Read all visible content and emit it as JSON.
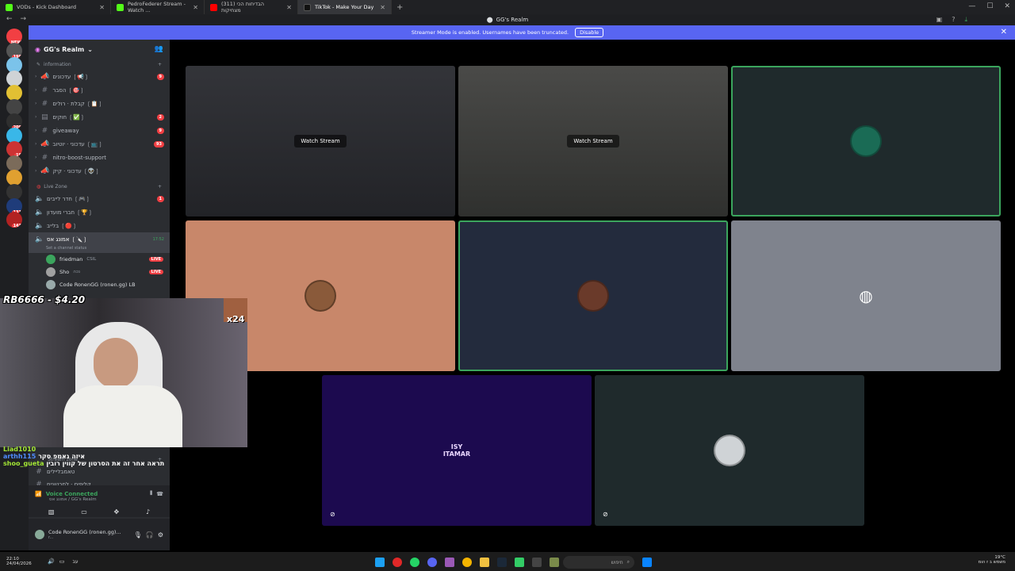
{
  "tabs": [
    {
      "title": "VODs - Kick Dashboard",
      "color": "#53fc18"
    },
    {
      "title": "PedroFederer Stream - Watch ...",
      "color": "#53fc18"
    },
    {
      "title": "(311) הבדיחות הכי מצחיקות",
      "color": "#ff0000"
    },
    {
      "title": "TikTok - Make Your Day",
      "color": "#111111"
    }
  ],
  "window": {
    "title": "GG's Realm"
  },
  "banner": {
    "text": "Streamer Mode is enabled. Usernames have been truncated.",
    "button": "Disable"
  },
  "server": {
    "name": "GG's Realm"
  },
  "servers": [
    {
      "badge": "NEW",
      "color": "#f23f43"
    },
    {
      "badge": "198",
      "color": "#555"
    },
    {
      "badge": "",
      "color": "#7bc3ea"
    },
    {
      "badge": "",
      "color": "#cfd3d6"
    },
    {
      "badge": "",
      "color": "#e2c033"
    },
    {
      "badge": "",
      "color": "#444"
    },
    {
      "badge": "209",
      "color": "#2f2f2f"
    },
    {
      "badge": "",
      "color": "#39b7e8"
    },
    {
      "badge": "19",
      "color": "#cc3333"
    },
    {
      "badge": "",
      "color": "#7b6b5a"
    },
    {
      "badge": "",
      "color": "#e0a030"
    },
    {
      "badge": "",
      "color": "#333"
    },
    {
      "badge": "131",
      "color": "#1f3c7a"
    },
    {
      "badge": "143",
      "color": "#b22222"
    }
  ],
  "categories": {
    "info": "information",
    "live": "Live Zone",
    "stream": "Stream zone"
  },
  "channels": [
    {
      "name": "עדכונים ❲📢❳",
      "badge": "9",
      "type": "ann"
    },
    {
      "name": "הסבר ❲🎯❳",
      "badge": "",
      "type": "text"
    },
    {
      "name": "קבלת · רולים ❲📋❳",
      "badge": "",
      "type": "text"
    },
    {
      "name": "חוקים ❲✅❳",
      "badge": "2",
      "type": "rules"
    },
    {
      "name": "giveaway",
      "badge": "9",
      "type": "text"
    },
    {
      "name": "עדכוני · יוטיוב ❲📺❳",
      "badge": "93",
      "type": "ann"
    },
    {
      "name": "nitro-boost-support",
      "badge": "",
      "type": "text"
    },
    {
      "name": "עדכוני · קיק ❲👽❳",
      "badge": "",
      "type": "ann"
    }
  ],
  "voice_channels": [
    {
      "name": "חדר לייבים ❲🎮❳",
      "badge": "1"
    },
    {
      "name": "חברי מועדון ❲🏆❳",
      "badge": ""
    },
    {
      "name": "בלייב ❲🔴❳",
      "badge": ""
    },
    {
      "name": "אמונג אס ❲🔪❳",
      "badge": "",
      "time": "17:52",
      "status": "Set a channel status"
    }
  ],
  "voice_users": [
    {
      "name": "friedman",
      "tag": "CSIL",
      "live": "LIVE",
      "color": "#3ba55d"
    },
    {
      "name": "Sho",
      "tag": "נכה",
      "live": "LIVE",
      "color": "#a0a0a0"
    },
    {
      "name": "Code RonenGG (ronen.gg) LB",
      "tag": "",
      "live": "",
      "color": "#9aa"
    }
  ],
  "stream_channels": [
    {
      "name": "טאמבליילים"
    },
    {
      "name": "קליפים · לסרטונים"
    }
  ],
  "voice_status": {
    "title": "Voice Connected",
    "subtitle": "אמונג אס / GG's Realm"
  },
  "user": {
    "name": "Code RonenGG (ronen.gg)...",
    "status": "r..."
  },
  "overlay": {
    "donation": "RB6666 - $4.20",
    "x24": "x24"
  },
  "chat": [
    {
      "user": "Liad1010",
      "text": "",
      "color": "#a3e635"
    },
    {
      "user": "arthh115",
      "text": "איזה גאמפ סקר",
      "color": "#4f8cff"
    },
    {
      "user": "shoo_gueta",
      "text": "תראה אחר זה את הסרטון של קווין רובין",
      "color": "#a3e635"
    }
  ],
  "tiles": [
    {
      "label": "Watch Stream",
      "bg": "#2a2b2f"
    },
    {
      "label": "Watch Stream",
      "bg": "#3a3a38"
    },
    {
      "label": "",
      "bg": "#1f2a2c"
    },
    {
      "label": "",
      "bg": "#c8876a"
    },
    {
      "label": "",
      "bg": "#232b3d"
    },
    {
      "label": "",
      "bg": "#7f838d"
    },
    {
      "label": "ISY ITAMAR",
      "bg": "#1c0a4f"
    },
    {
      "label": "",
      "bg": "#1f2a2c"
    }
  ],
  "taskbar": {
    "time": "22:10",
    "date": "24/04/2026",
    "search": "חיפוש",
    "lang": "עב",
    "weather": "19°C",
    "weather_sub": "משמש ב ז הומ"
  }
}
